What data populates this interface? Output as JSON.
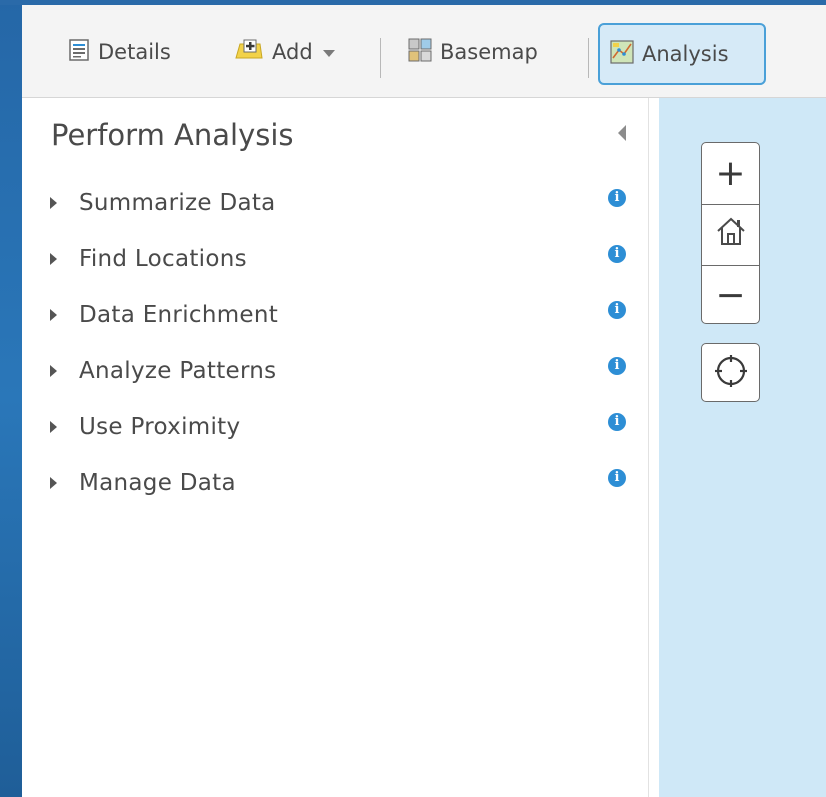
{
  "toolbar": {
    "details_label": "Details",
    "add_label": "Add",
    "basemap_label": "Basemap",
    "analysis_label": "Analysis",
    "icons": {
      "details": "details-list-icon",
      "add": "add-content-icon",
      "basemap": "basemap-grid-icon",
      "analysis": "analysis-map-icon",
      "add_menu": "chevron-down-icon"
    }
  },
  "panel": {
    "title": "Perform Analysis",
    "items": [
      {
        "label": "Summarize Data"
      },
      {
        "label": "Find Locations"
      },
      {
        "label": "Data Enrichment"
      },
      {
        "label": "Analyze Patterns"
      },
      {
        "label": "Use Proximity"
      },
      {
        "label": "Manage Data"
      }
    ],
    "info_glyph": "i"
  },
  "map_controls": {
    "zoom_in": "+",
    "zoom_out": "−",
    "icons": {
      "home": "home-icon",
      "locate": "locate-crosshair-icon"
    }
  },
  "colors": {
    "active_tab_bg": "#d6eaf7",
    "active_tab_border": "#4aa0d8",
    "info_icon": "#2d8ed5",
    "map_bg": "#cfe8f7",
    "desktop_bg": "#2574b3"
  }
}
